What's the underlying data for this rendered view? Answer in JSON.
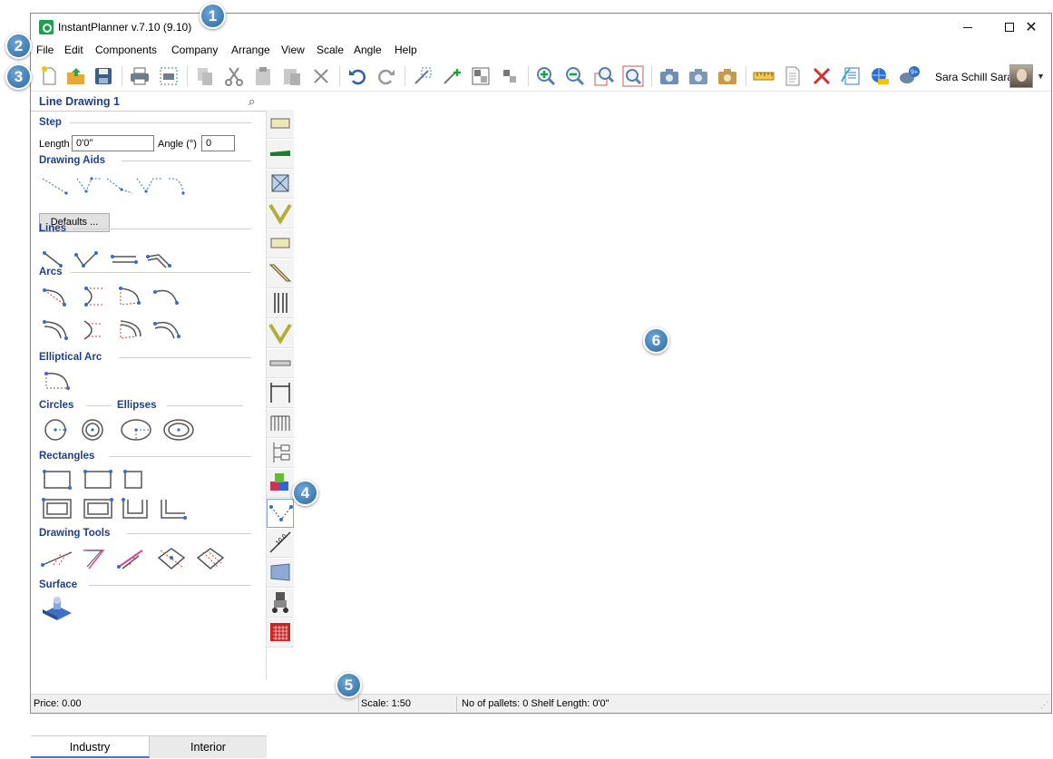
{
  "window": {
    "title": "InstantPlanner v.7.10 (9.10)",
    "controls": [
      "minimize",
      "maximize",
      "close"
    ]
  },
  "menu": [
    "File",
    "Edit",
    "Components",
    "Company",
    "Arrange",
    "View",
    "Scale",
    "Angle",
    "Help"
  ],
  "toolbar": {
    "buttons": [
      "new-icon",
      "open-icon",
      "save-icon",
      "print-icon",
      "print-preview-icon",
      "copy-icon",
      "cut-icon",
      "paste-icon",
      "paste-special-icon",
      "delete-icon",
      "undo-icon",
      "redo-icon",
      "select-icon",
      "add-point-icon",
      "group-icon",
      "ungroup-icon",
      "zoom-in-icon",
      "zoom-out-icon",
      "zoom-window-icon",
      "zoom-all-icon",
      "camera-3d-icon",
      "camera-icon",
      "camera-render-icon",
      "measure-icon",
      "report-icon",
      "close-red-icon",
      "catalog-icon",
      "web-icon",
      "chat-icon"
    ],
    "user_name": "Sara Schill Saran",
    "notification_badge": "9+"
  },
  "panel": {
    "title": "Line Drawing 1",
    "step": {
      "label": "Step",
      "length_label": "Length",
      "length_value": "0'0\"",
      "angle_label": "Angle (°)",
      "angle_value": "0"
    },
    "sections": {
      "drawing_aids": "Drawing Aids",
      "defaults_button": "Defaults ...",
      "lines": "Lines",
      "arcs": "Arcs",
      "elliptical_arc": "Elliptical Arc",
      "circles": "Circles",
      "ellipses": "Ellipses",
      "rectangles": "Rectangles",
      "drawing_tools": "Drawing Tools",
      "surface": "Surface"
    },
    "tabs": [
      {
        "label": "Industry",
        "active": true
      },
      {
        "label": "Interior",
        "active": false
      }
    ]
  },
  "vertical_tools": [
    "shelf-icon",
    "green-shelf-icon",
    "box-icon",
    "v-frame-icon",
    "panel-icon",
    "diagonal-beam-icon",
    "uprights-icon",
    "v-frame-2-icon",
    "beam-icon",
    "frame-icon",
    "grid-icon",
    "tree-icon",
    "cubes-icon",
    "line-drawing-icon",
    "dimension-icon",
    "plate-icon",
    "person-icon",
    "calendar-icon"
  ],
  "status": {
    "price": "Price: 0.00",
    "scale": "Scale: 1:50",
    "pallets": "No of pallets: 0 Shelf Length: 0'0\""
  },
  "callouts": [
    "1",
    "2",
    "3",
    "4",
    "5",
    "6"
  ],
  "colors": {
    "section_title": "#1f3e8c",
    "callout": "#2a6aa3",
    "accent_green": "#19a24a",
    "delete_red": "#d32f2f"
  }
}
